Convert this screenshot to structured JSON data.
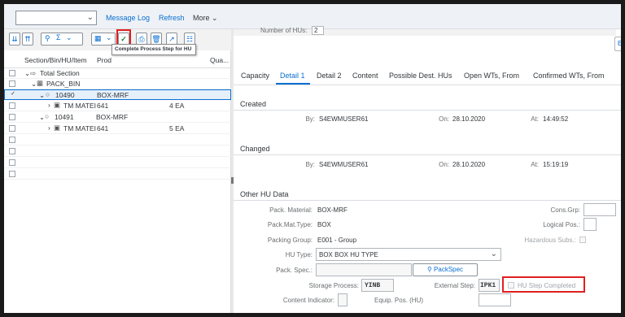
{
  "topbar": {
    "select_value": "",
    "message_log": "Message Log",
    "refresh": "Refresh",
    "more": "More"
  },
  "left": {
    "tooltip": "Complete Process Step for HU",
    "columns": [
      "Section/Bin/HU/Item",
      "Prod",
      "Qua..."
    ],
    "rows": [
      {
        "label": "Total Section",
        "prod": "",
        "qty": ""
      },
      {
        "label": "PACK_BIN",
        "prod": "",
        "qty": ""
      },
      {
        "label": "10490",
        "prod": "BOX-MRF",
        "qty": ""
      },
      {
        "label": "TM MATEI",
        "prod": "641",
        "qty": "4 EA"
      },
      {
        "label": "10491",
        "prod": "BOX-MRF",
        "qty": ""
      },
      {
        "label": "TM MATEI",
        "prod": "641",
        "qty": "5 EA"
      }
    ]
  },
  "right": {
    "top_label": "Number of HUs:",
    "top_value": "2",
    "ex_button": "Ex",
    "tabs": [
      "Capacity",
      "Detail 1",
      "Detail 2",
      "Content",
      "Possible Dest. HUs",
      "Open WTs, From",
      "Confirmed WTs, From"
    ],
    "active_tab": "Detail 1",
    "created": {
      "title": "Created",
      "by_label": "By:",
      "by": "S4EWMUSER61",
      "on_label": "On:",
      "on": "28.10.2020",
      "at_label": "At:",
      "at": "14:49:52"
    },
    "changed": {
      "title": "Changed",
      "by_label": "By:",
      "by": "S4EWMUSER61",
      "on_label": "On:",
      "on": "28.10.2020",
      "at_label": "At:",
      "at": "15:19:19"
    },
    "other": {
      "title": "Other HU Data",
      "pack_material_label": "Pack. Material:",
      "pack_material": "BOX-MRF",
      "pack_mat_type_label": "Pack.Mat.Type:",
      "pack_mat_type": "BOX",
      "packing_group_label": "Packing Group:",
      "packing_group": "E001 - Group",
      "hu_type_label": "HU Type:",
      "hu_type": "BOX BOX HU TYPE",
      "pack_spec_label": "Pack. Spec.:",
      "pack_spec_button": "PackSpec",
      "storage_process_label": "Storage Process:",
      "storage_process": "YINB",
      "external_step_label": "External Step:",
      "external_step": "IPK1",
      "hu_step_completed": "HU Step Completed",
      "content_indicator_label": "Content Indicator:",
      "equip_pos_label": "Equip. Pos. (HU)",
      "cons_grp_label": "Cons.Grp:",
      "logical_pos_label": "Logical Pos.:",
      "hazardous_label": "Hazardous Subs.:"
    }
  }
}
